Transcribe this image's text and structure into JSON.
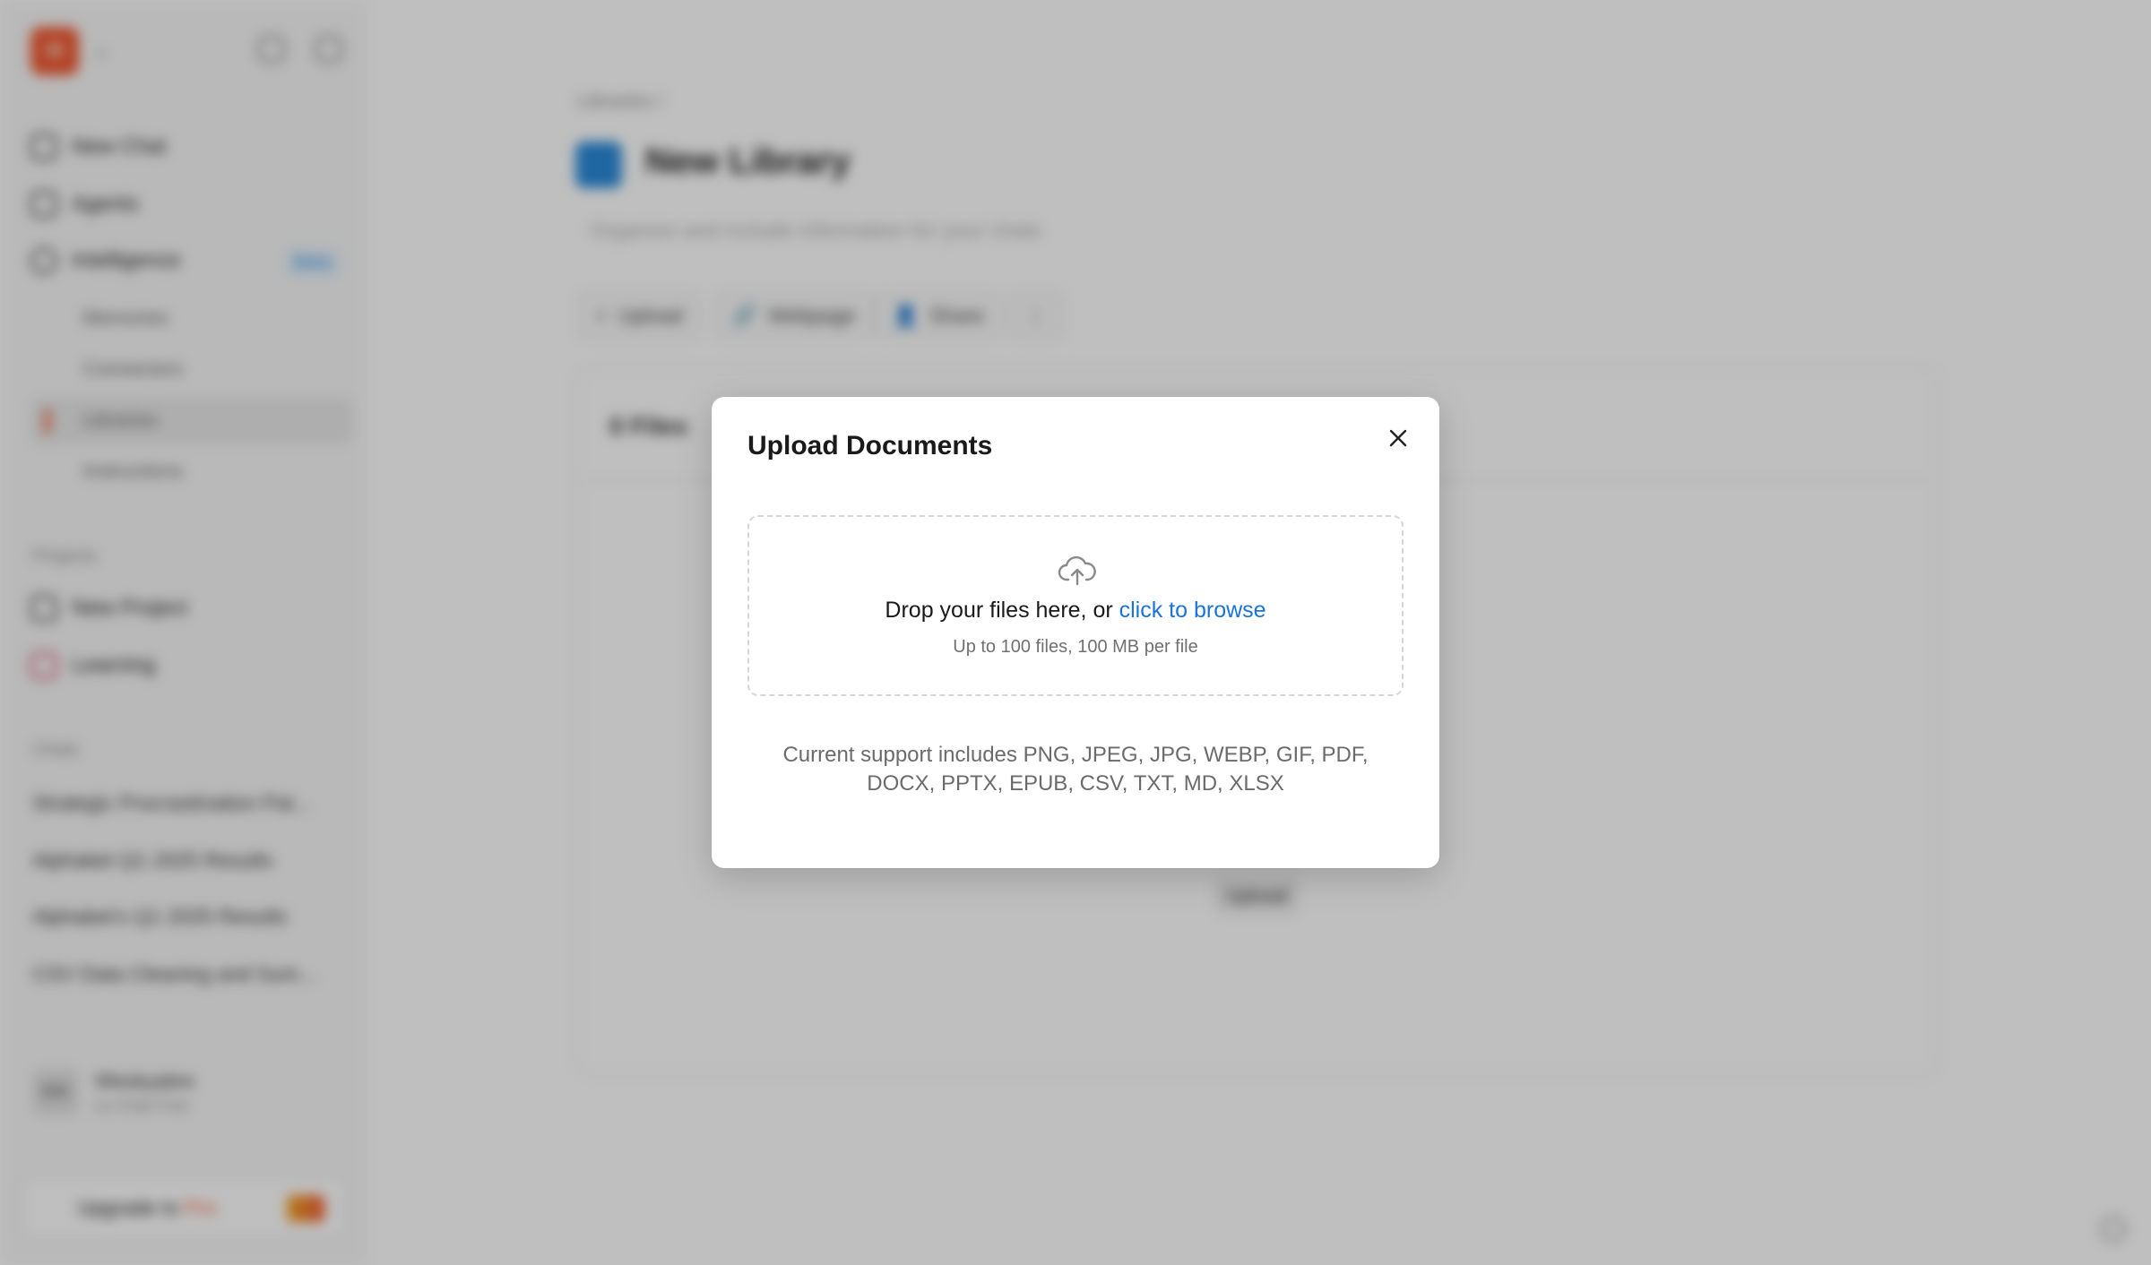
{
  "sidebar": {
    "logo_letter": "H",
    "nav": {
      "new_chat": "New Chat",
      "agents": "Agents",
      "intelligence": "Intelligence",
      "intelligence_badge": "Beta"
    },
    "sub_items": [
      "Memories",
      "Connectors",
      "Libraries",
      "Instructions"
    ],
    "projects_heading": "Projects",
    "projects": [
      "New Project",
      "Learning"
    ],
    "chats_heading": "Chats",
    "chats": [
      "Strategic Procrastination Pat...",
      "Alphabet Q1 2025 Results",
      "Alphabet's Q1 2025 Results",
      "CSV Data Cleaning and Sum..."
    ],
    "user": {
      "initials": "WK",
      "name": "Weokyabre",
      "plan": "Le Chat Free"
    },
    "upgrade": {
      "label": "Upgrade to",
      "pro": "Pro"
    }
  },
  "main": {
    "breadcrumb": "Libraries  /",
    "title": "New Library",
    "description": "Organize and include information for your chats",
    "toolbar": {
      "upload": "Upload",
      "webpage": "Webpage",
      "share": "Share",
      "more": "⋮"
    },
    "panel_title": "0 Files",
    "panel_upload": "Upload"
  },
  "modal": {
    "title": "Upload Documents",
    "drop_text": "Drop your files here, or ",
    "drop_link": "click to browse",
    "drop_limit": "Up to 100 files, 100 MB per file",
    "support_text": "Current support includes PNG, JPEG, JPG, WEBP, GIF, PDF, DOCX, PPTX, EPUB, CSV, TXT, MD, XLSX"
  },
  "colors": {
    "brand": "#f05a33",
    "link": "#1a73d9",
    "library_icon": "#2a8ad8"
  }
}
